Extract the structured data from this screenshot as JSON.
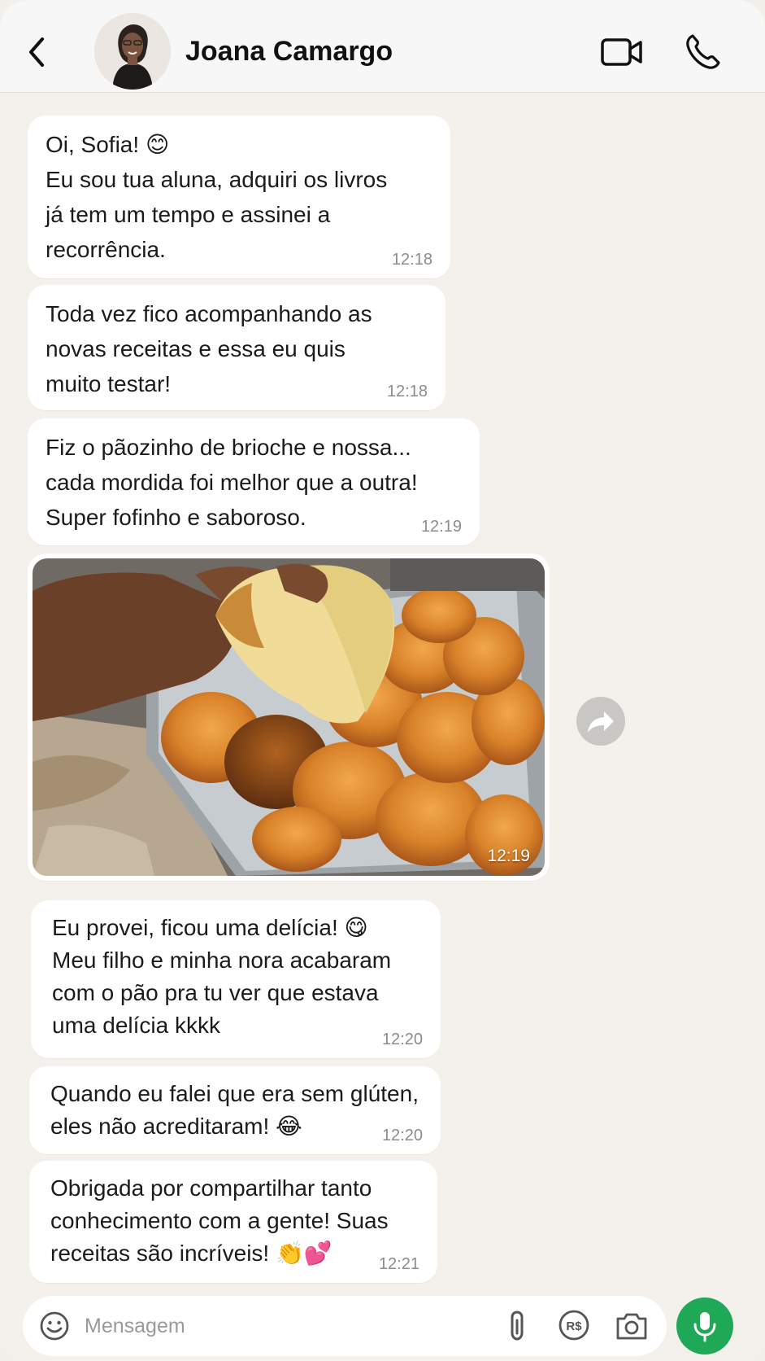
{
  "header": {
    "contact_name": "Joana Camargo"
  },
  "messages": [
    {
      "text": "Oi, Sofia! ",
      "emoji": "😊",
      "text2": "\nEu sou tua aluna, adquiri os livros\njá tem um tempo e assinei a\nrecorrência.",
      "time": "12:18"
    },
    {
      "text": "Toda vez fico acompanhando as\nnovas receitas e essa eu quis\nmuito testar!",
      "time": "12:18"
    },
    {
      "text": "Fiz o pãozinho de brioche e nossa...\ncada mordida foi melhor que a outra!\nSuper fofinho e saboroso.",
      "time": "12:19"
    },
    {
      "text": "Eu provei, ficou uma delícia! ",
      "emoji": "😋",
      "text2": "\nMeu filho e minha nora acabaram\ncom o pão pra tu ver que estava\numa delícia kkkk",
      "time": "12:20"
    },
    {
      "text": "Quando eu falei que era sem glúten,\neles não acreditaram! ",
      "emoji": "😂",
      "time": "12:20"
    },
    {
      "text": "Obrigada por compartilhar tanto\nconhecimento com a gente! Suas\nreceitas são incríveis! ",
      "emoji": "👏💕",
      "time": "12:21"
    }
  ],
  "photo_message": {
    "time": "12:19"
  },
  "composer": {
    "placeholder": "Mensagem"
  },
  "icons": {
    "back": "chevron-left-icon",
    "video": "video-camera-icon",
    "call": "phone-icon",
    "forward": "forward-arrow-icon",
    "emoji": "smiley-icon",
    "attach": "paperclip-icon",
    "pay": "payment-icon",
    "camera": "camera-icon",
    "mic": "microphone-icon"
  },
  "colors": {
    "background": "#f4f0eb",
    "bubble": "#ffffff",
    "accent": "#1fa855"
  }
}
